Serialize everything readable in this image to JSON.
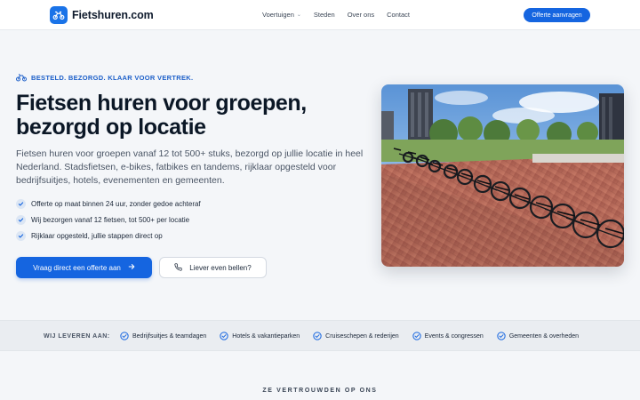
{
  "header": {
    "brand": "Fietshuren.com",
    "nav": [
      {
        "label": "Voertuigen",
        "has_dropdown": true
      },
      {
        "label": "Steden"
      },
      {
        "label": "Over ons"
      },
      {
        "label": "Contact"
      }
    ],
    "cta_label": "Offerte aanvragen"
  },
  "hero": {
    "eyebrow": "BESTELD. BEZORGD. KLAAR VOOR VERTREK.",
    "title_line1": "Fietsen huren voor groepen,",
    "title_line2": "bezorgd op locatie",
    "subtitle": "Fietsen huren voor groepen vanaf 12 tot 500+ stuks, bezorgd op jullie locatie in heel Nederland. Stadsfietsen, e-bikes, fatbikes en tandems, rijklaar opgesteld voor bedrijfsuitjes, hotels, evenementen en gemeenten.",
    "checks": [
      "Offerte op maat binnen 24 uur, zonder gedoe achteraf",
      "Wij bezorgen vanaf 12 fietsen, tot 500+ per locatie",
      "Rijklaar opgesteld, jullie stappen direct op"
    ],
    "primary_cta": "Vraag direct een offerte aan",
    "secondary_cta": "Liever even bellen?"
  },
  "band": {
    "label": "WIJ LEVEREN AAN:",
    "items": [
      "Bedrijfsuitjes & teamdagen",
      "Hotels & vakantieparken",
      "Cruiseschepen & rederijen",
      "Events & congressen",
      "Gemeenten & overheden"
    ]
  },
  "trusted_heading": "ZE VERTROUWDEN OP ONS",
  "colors": {
    "accent": "#1565e0",
    "eyebrow": "#1c5fc9",
    "text": "#0f1b2d",
    "background": "#f4f6f9"
  },
  "icons": {
    "brand": "bike-icon",
    "check": "check-icon",
    "arrow": "arrow-right-icon",
    "phone": "phone-icon",
    "badge": "check-badge-icon"
  }
}
